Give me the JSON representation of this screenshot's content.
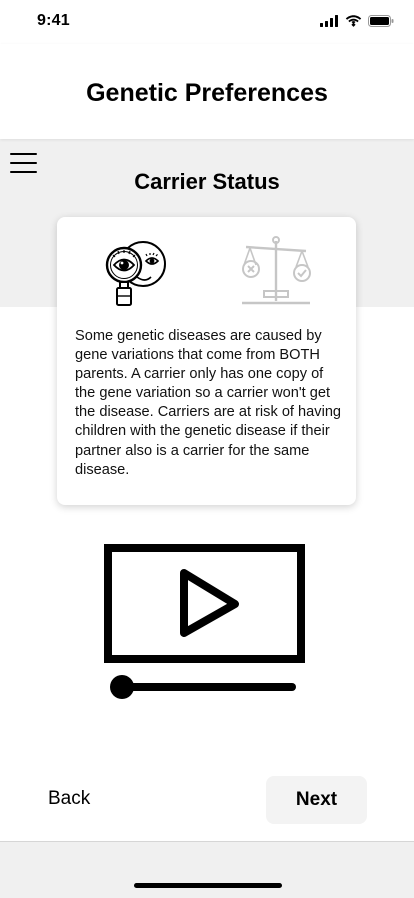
{
  "status_bar": {
    "time": "9:41",
    "icons": [
      "signal-icon",
      "wifi-icon",
      "battery-icon"
    ]
  },
  "header": {
    "title": "Genetic Preferences"
  },
  "menu": {
    "icon": "hamburger-menu-icon"
  },
  "section": {
    "title": "Carrier Status"
  },
  "card": {
    "icons": [
      "magnifier-eye-icon",
      "scale-icon"
    ],
    "text": "Some genetic diseases are caused by gene variations that come from BOTH parents. A carrier only has one copy of the gene variation so a carrier won't get the disease. Carriers are at risk of having children with the genetic disease if their partner also is a carrier for the same disease."
  },
  "video": {
    "icon": "play-icon",
    "progress": 0
  },
  "nav": {
    "back_label": "Back",
    "next_label": "Next"
  },
  "colors": {
    "background": "#ffffff",
    "band": "#f0f0f0",
    "next_button_bg": "#f3f3f3",
    "text": "#000000"
  }
}
